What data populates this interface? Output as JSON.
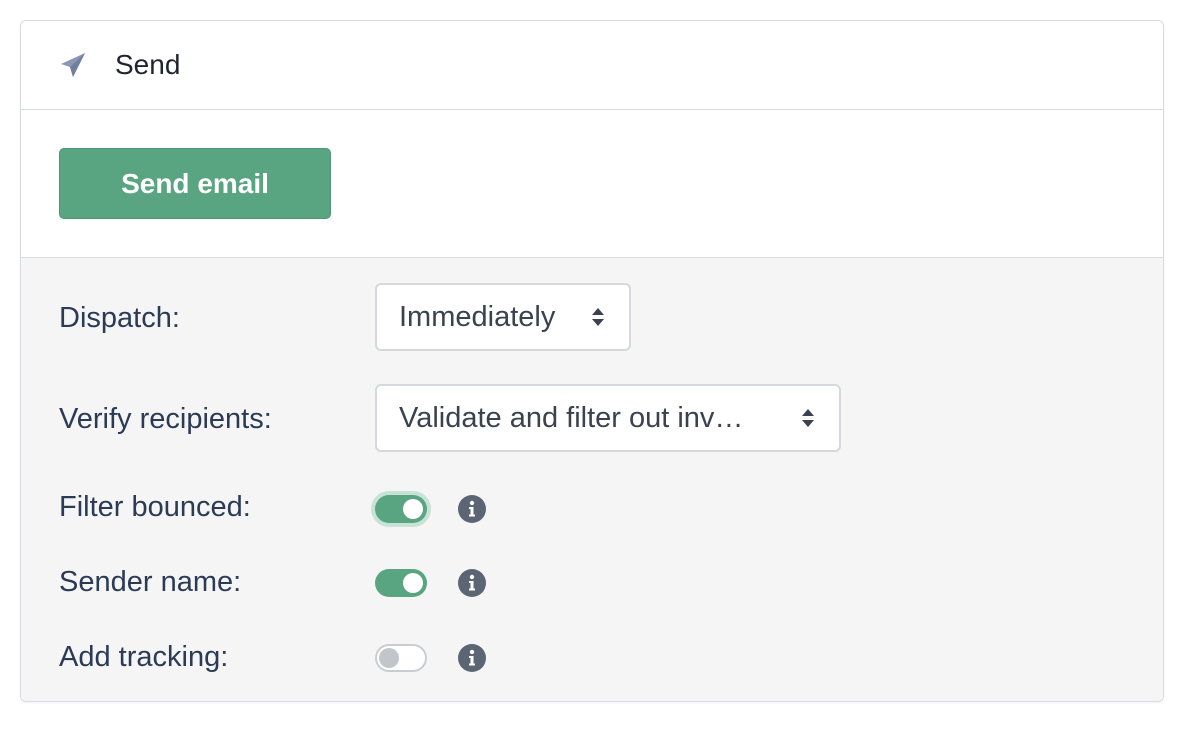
{
  "header": {
    "title": "Send",
    "icon": "paper-plane-icon"
  },
  "actions": {
    "send_label": "Send email",
    "accent": "#59a582"
  },
  "settings": {
    "dispatch": {
      "label": "Dispatch:",
      "value": "Immediately"
    },
    "verify": {
      "label": "Verify recipients:",
      "value": "Validate and filter out inv…"
    },
    "filter_bounced": {
      "label": "Filter bounced:",
      "enabled": true
    },
    "sender_name": {
      "label": "Sender name:",
      "enabled": true
    },
    "add_tracking": {
      "label": "Add tracking:",
      "enabled": false
    }
  }
}
